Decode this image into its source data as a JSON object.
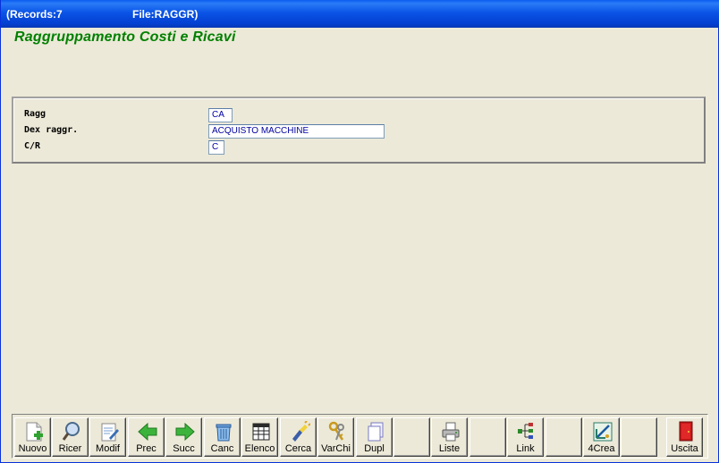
{
  "titlebar": {
    "records": "(Records:7",
    "file": "File:RAGGR)"
  },
  "form": {
    "title": "Raggruppamento Costi e Ricavi",
    "fields": [
      {
        "label": "Ragg",
        "value": "CA"
      },
      {
        "label": "Dex raggr.",
        "value": "ACQUISTO MACCHINE"
      },
      {
        "label": "C/R",
        "value": "C"
      }
    ]
  },
  "toolbar": {
    "buttons": [
      {
        "label": "Nuovo",
        "icon": "new-document-icon"
      },
      {
        "label": "Ricer",
        "icon": "magnifier-icon"
      },
      {
        "label": "Modif",
        "icon": "edit-document-icon"
      },
      {
        "label": "Prec",
        "icon": "arrow-left-icon"
      },
      {
        "label": "Succ",
        "icon": "arrow-right-icon"
      },
      {
        "label": "Canc",
        "icon": "trash-icon"
      },
      {
        "label": "Elenco",
        "icon": "table-icon"
      },
      {
        "label": "Cerca",
        "icon": "flashlight-icon"
      },
      {
        "label": "VarChi",
        "icon": "keys-icon"
      },
      {
        "label": "Dupl",
        "icon": "duplicate-icon"
      },
      {
        "label": "",
        "icon": ""
      },
      {
        "label": "Liste",
        "icon": "printer-icon"
      },
      {
        "label": "",
        "icon": ""
      },
      {
        "label": "Link",
        "icon": "tree-icon"
      },
      {
        "label": "",
        "icon": ""
      },
      {
        "label": "4Crea",
        "icon": "create-tool-icon"
      },
      {
        "label": "",
        "icon": ""
      },
      {
        "label": "Uscita",
        "icon": "exit-door-icon"
      }
    ]
  }
}
